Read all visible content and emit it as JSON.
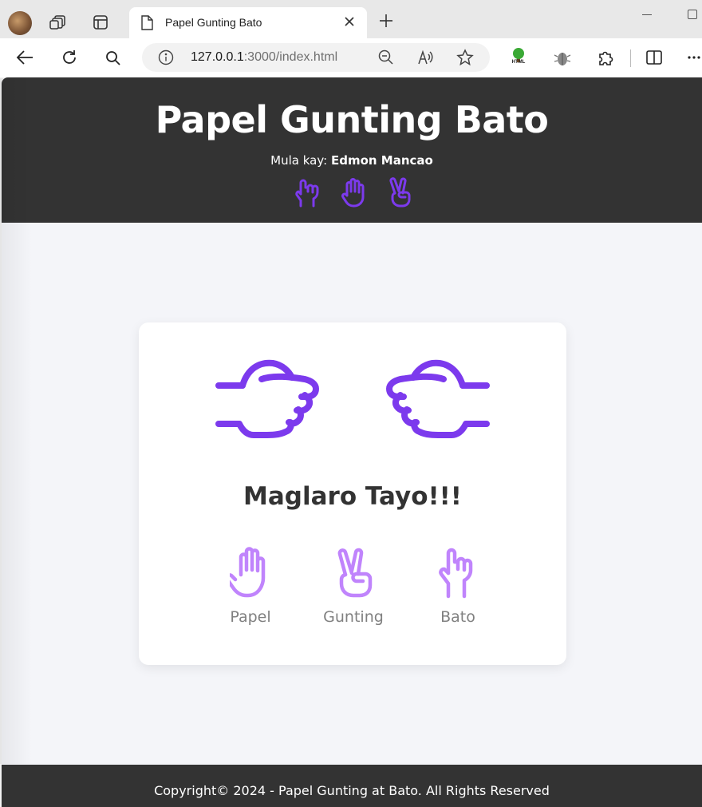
{
  "browser": {
    "tab_title": "Papel Gunting Bato",
    "url_host": "127.0.0.1",
    "url_rest": ":3000/index.html",
    "extension_html_label": "HTML"
  },
  "header": {
    "title": "Papel Gunting Bato",
    "byline_prefix": "Mula kay:",
    "author": "Edmon Mancao",
    "icons": [
      "fist-icon",
      "palm-icon",
      "peace-icon"
    ]
  },
  "game": {
    "status": "Maglaro Tayo!!!",
    "player_hand": "fist-pointing-right-icon",
    "computer_hand": "fist-pointing-left-icon",
    "choices": [
      {
        "label": "Papel",
        "icon": "palm-icon"
      },
      {
        "label": "Gunting",
        "icon": "peace-icon"
      },
      {
        "label": "Bato",
        "icon": "fist-icon"
      }
    ]
  },
  "footer": {
    "copyright": "Copyright© 2024 - Papel Gunting at Bato. All Rights Reserved"
  },
  "colors": {
    "accent": "#7c3aed",
    "accent_light": "#c084fc",
    "header_bg": "#333333",
    "page_bg": "#f4f5f9"
  }
}
